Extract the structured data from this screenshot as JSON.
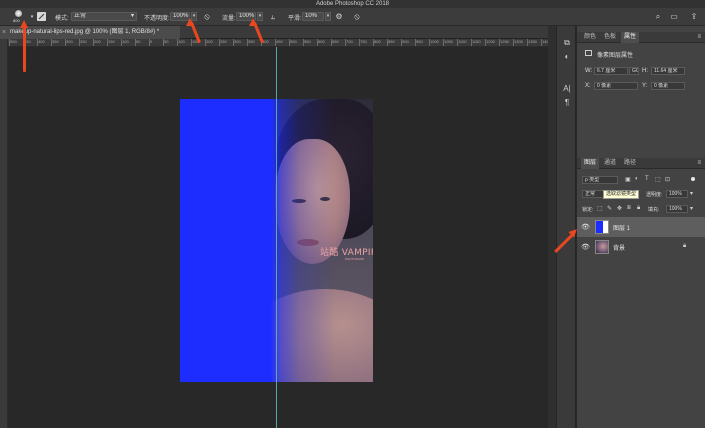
{
  "app": {
    "title": "Adobe Photoshop CC 2018"
  },
  "options_bar": {
    "brush_size": "800",
    "mode_label": "模式:",
    "mode_value": "正常",
    "opacity_label": "不透明度:",
    "opacity_value": "100%",
    "flow_label": "流量:",
    "flow_value": "100%",
    "smoothing_label": "平滑:",
    "smoothing_value": "10%"
  },
  "document": {
    "tab_title": "makeup-natural-lips-red.jpg @ 100% (图层 1, RGB/8#) *",
    "watermark": "站酷 VAMPIREE",
    "watermark_sub": "PHOTOSHOP"
  },
  "rulers": {
    "top_ticks": [
      "500",
      "450",
      "400",
      "350",
      "300",
      "250",
      "200",
      "150",
      "100",
      "50",
      "0",
      "50",
      "100",
      "150",
      "200",
      "250",
      "300",
      "350",
      "400",
      "450",
      "500",
      "550",
      "600",
      "650",
      "700",
      "750",
      "800",
      "850",
      "900",
      "950",
      "1000",
      "1050",
      "1100",
      "1150",
      "1200",
      "1250",
      "1300",
      "1350",
      "1400",
      "1450"
    ]
  },
  "properties_panel": {
    "tabs": [
      "颜色",
      "色板",
      "属性"
    ],
    "section_title": "像素图层属性",
    "w_label": "W:",
    "w_value": "6.7 厘米",
    "link_label": "GO",
    "h_label": "H:",
    "h_value": "11.64 厘米",
    "x_label": "X:",
    "x_value": "0 像素",
    "y_label": "Y:",
    "y_value": "0 像素"
  },
  "layers_panel": {
    "tabs": [
      "图层",
      "通道",
      "路径"
    ],
    "filter_kind": "ρ 类型",
    "blend_mode": "正常",
    "tooltip": "选取滤镜类型",
    "opacity_label": "透明度:",
    "opacity_value": "100%",
    "lock_label": "锁定:",
    "fill_label": "填充:",
    "fill_value": "100%",
    "layers": [
      {
        "name": "图层 1",
        "selected": true
      },
      {
        "name": "背景",
        "selected": false
      }
    ]
  }
}
